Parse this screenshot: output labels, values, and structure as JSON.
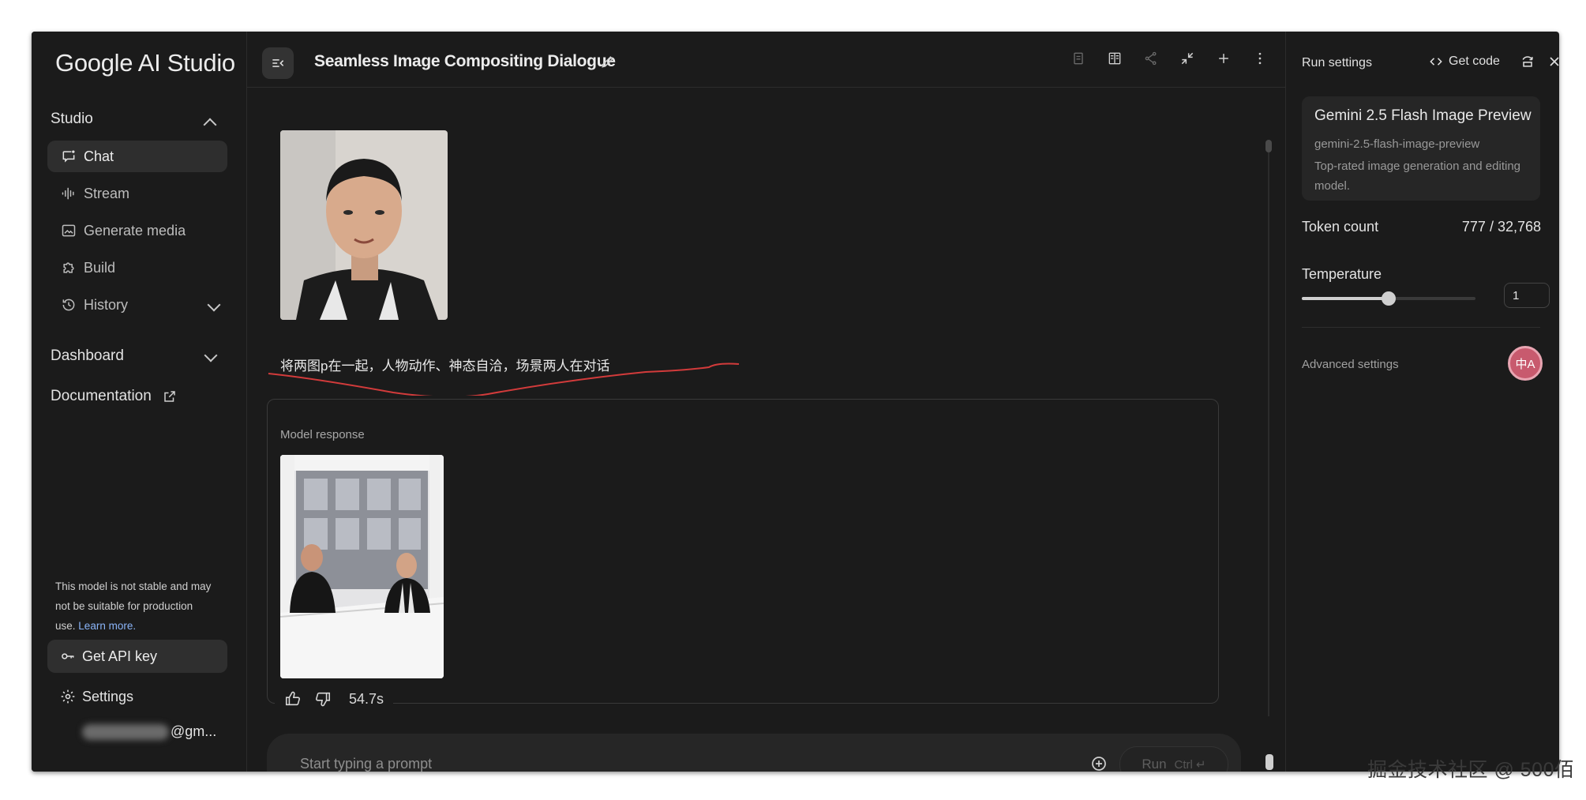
{
  "app": {
    "logo_text": "Google AI Studio"
  },
  "sidebar": {
    "studio_label": "Studio",
    "items": [
      {
        "label": "Chat",
        "icon": "chat-icon"
      },
      {
        "label": "Stream",
        "icon": "stream-icon"
      },
      {
        "label": "Generate media",
        "icon": "image-icon"
      },
      {
        "label": "Build",
        "icon": "build-icon"
      },
      {
        "label": "History",
        "icon": "history-icon"
      }
    ],
    "dashboard_label": "Dashboard",
    "documentation_label": "Documentation",
    "disclaimer": "This model is not stable and may not be suitable for production use.",
    "learn_more": "Learn more.",
    "api_key_label": "Get API key",
    "settings_label": "Settings",
    "account_suffix": "@gm..."
  },
  "header": {
    "title": "Seamless Image Compositing Dialogue",
    "icons": [
      "compare-icon",
      "book-icon",
      "share-icon",
      "compress-icon",
      "add-icon",
      "more-icon"
    ]
  },
  "chat": {
    "user_prompt": "将两图p在一起，人物动作、神态自洽，场景两人在对话",
    "response_label": "Model response",
    "response_time": "54.7s",
    "input_placeholder": "Start typing a prompt",
    "run_label": "Run",
    "run_shortcut": "Ctrl"
  },
  "run_settings": {
    "title": "Run settings",
    "get_code_label": "Get code",
    "model_name": "Gemini 2.5 Flash Image Preview",
    "model_id": "gemini-2.5-flash-image-preview",
    "model_desc": "Top-rated image generation and editing model.",
    "token_label": "Token count",
    "token_value": "777 / 32,768",
    "temperature_label": "Temperature",
    "temperature_value": "1",
    "temperature_fraction": 0.5,
    "advanced_label": "Advanced settings",
    "translate_badge": "中A"
  },
  "watermark": "掘金技术社区 @ 500佰"
}
